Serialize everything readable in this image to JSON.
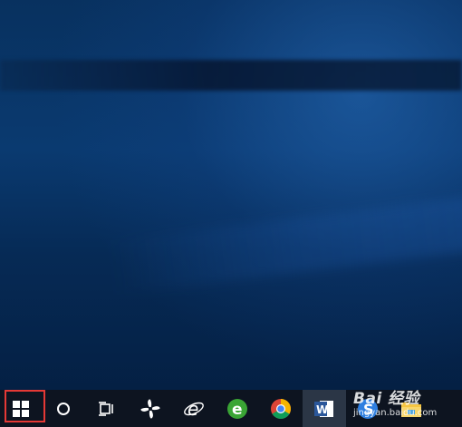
{
  "desktop": {
    "background": "blue-wallpaper"
  },
  "taskbar": {
    "items": [
      {
        "name": "start-button",
        "icon": "windows-logo-icon"
      },
      {
        "name": "cortana-button",
        "icon": "circle-icon"
      },
      {
        "name": "task-view-button",
        "icon": "task-view-icon"
      },
      {
        "name": "pinwheel-app",
        "icon": "pinwheel-icon"
      },
      {
        "name": "internet-explorer",
        "icon": "ie-icon"
      },
      {
        "name": "360-browser",
        "icon": "green-e-icon"
      },
      {
        "name": "chrome",
        "icon": "chrome-icon"
      },
      {
        "name": "word",
        "icon": "word-icon"
      },
      {
        "name": "sogou",
        "icon": "s-icon"
      },
      {
        "name": "file-explorer",
        "icon": "folder-icon"
      }
    ],
    "highlight_color": "#e53935",
    "background_color": "#0d1420"
  },
  "watermark": {
    "main": "Bai 经验",
    "sub": "jingyan.baidu.com"
  }
}
